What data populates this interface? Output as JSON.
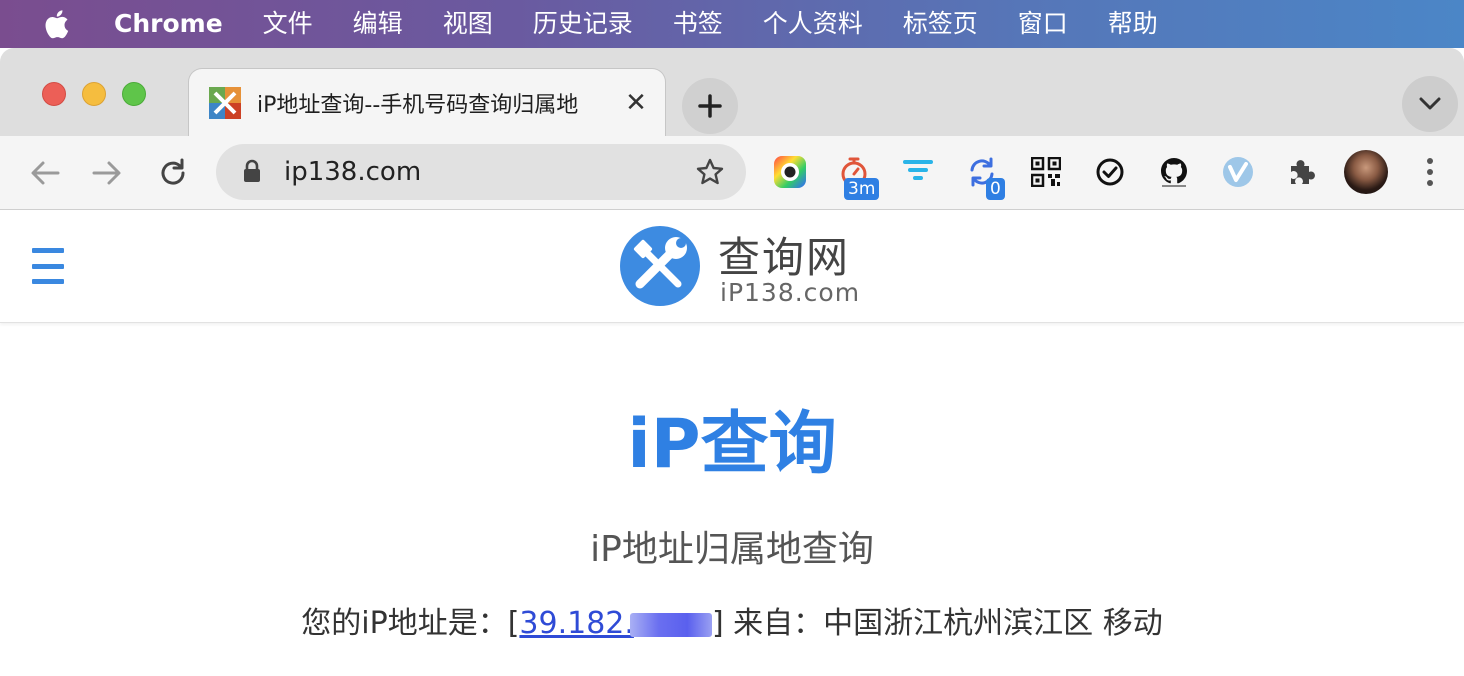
{
  "menubar": {
    "app_name": "Chrome",
    "items": [
      "文件",
      "编辑",
      "视图",
      "历史记录",
      "书签",
      "个人资料",
      "标签页",
      "窗口",
      "帮助"
    ]
  },
  "tab": {
    "title": "iP地址查询--手机号码查询归属地",
    "close_glyph": "✕"
  },
  "toolbar": {
    "url": "ip138.com",
    "extensions": [
      {
        "icon": "color-picker-icon",
        "badge": ""
      },
      {
        "icon": "timer-icon",
        "badge": "3m"
      },
      {
        "icon": "filter-icon",
        "badge": ""
      },
      {
        "icon": "refresh-sync-icon",
        "badge": "0"
      },
      {
        "icon": "qr-code-icon",
        "badge": ""
      },
      {
        "icon": "check-circle-icon",
        "badge": ""
      },
      {
        "icon": "github-icon",
        "badge": ""
      },
      {
        "icon": "vimeo-icon",
        "badge": ""
      },
      {
        "icon": "puzzle-icon",
        "badge": ""
      }
    ]
  },
  "site": {
    "logo_cn": "查询网",
    "logo_en": "iP138.com",
    "title": "iP查询",
    "subtitle": "iP地址归属地查询",
    "ip_prefix": "您的iP地址是：[",
    "ip_value": "39.182.",
    "ip_suffix": "] 来自：中国浙江杭州滨江区 移动"
  },
  "colors": {
    "accent": "#2f80e3",
    "link": "#2f4bd6"
  }
}
